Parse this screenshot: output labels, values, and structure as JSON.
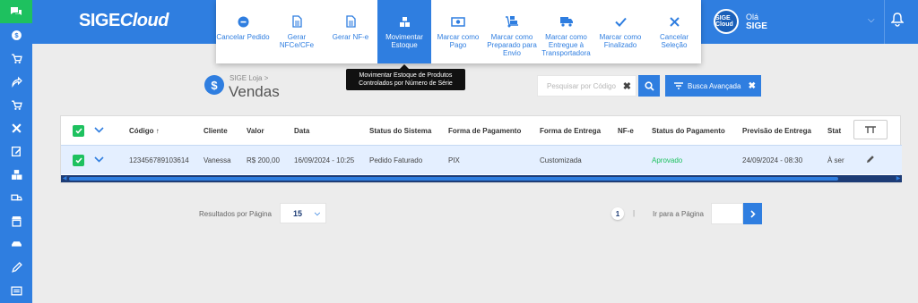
{
  "app": {
    "logo_text": "SIGECloud",
    "logo_main": "SIGE",
    "logo_cloud": "Cloud"
  },
  "user": {
    "greeting": "Olá",
    "name": "SIGE",
    "avatar_text": "SIGE Cloud"
  },
  "toolbar": {
    "buttons": [
      {
        "label": "Cancelar Pedido",
        "icon": "minus-circle-icon"
      },
      {
        "label": "Gerar NFCe/CFe",
        "icon": "document-icon"
      },
      {
        "label": "Gerar NF-e",
        "icon": "document-icon"
      },
      {
        "label": "Movimentar Estoque",
        "icon": "boxes-icon",
        "active": true
      },
      {
        "label": "Marcar como Pago",
        "icon": "money-icon"
      },
      {
        "label": "Marcar como Preparado para Envio",
        "icon": "dolly-icon"
      },
      {
        "label": "Marcar como Entregue à Transportadora",
        "icon": "truck-icon"
      },
      {
        "label": "Marcar como Finalizado",
        "icon": "check-icon"
      },
      {
        "label": "Cancelar Seleção",
        "icon": "close-icon"
      }
    ],
    "tooltip": "Movimentar Estoque de Produtos Controlados por Número de Série"
  },
  "page": {
    "breadcrumb": "SIGE Loja >",
    "title": "Vendas",
    "title_icon": "$"
  },
  "search": {
    "placeholder": "Pesquisar por Código",
    "clear": "✖",
    "advanced_label": "Busca Avançada",
    "advanced_clear": "✖"
  },
  "table": {
    "headers": {
      "codigo": "Código ↑",
      "cliente": "Cliente",
      "valor": "Valor",
      "data": "Data",
      "status_sistema": "Status do Sistema",
      "forma_pagamento": "Forma de Pagamento",
      "forma_entrega": "Forma de Entrega",
      "nfe": "NF-e",
      "status_pagamento": "Status do Pagamento",
      "previsao_entrega": "Previsão de Entrega",
      "status_trunc": "Stat"
    },
    "rows": [
      {
        "codigo": "123456789103614",
        "cliente": "Vanessa",
        "valor": "R$ 200,00",
        "data": "16/09/2024 - 10:25",
        "status_sistema": "Pedido Faturado",
        "forma_pagamento": "PIX",
        "forma_entrega": "Customizada",
        "nfe": "",
        "status_pagamento": "Aprovado",
        "previsao_entrega": "24/09/2024 - 08:30",
        "status_trunc": "À ser"
      }
    ]
  },
  "pagination": {
    "rpp_label": "Resultados por Página",
    "rpp_value": "15",
    "current_page": "1",
    "separator": "|",
    "goto_label": "Ir para a Página",
    "goto_value": ""
  },
  "colors": {
    "primary": "#2f7ee0",
    "success": "#1ec15f",
    "dark_blue": "#1d3c76",
    "approved": "#1ec15f"
  }
}
